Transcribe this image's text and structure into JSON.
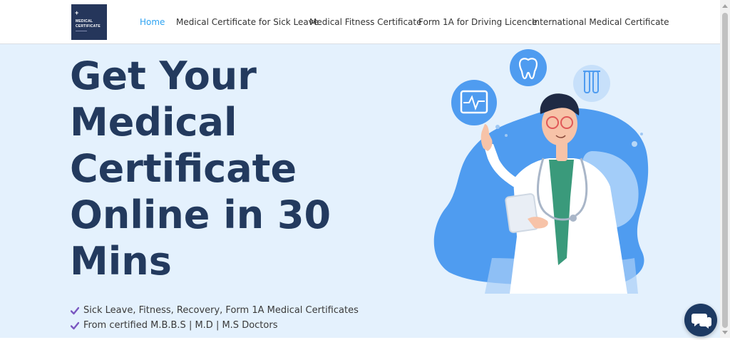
{
  "header": {
    "logo": {
      "line1": "MEDICAL",
      "line2": "CERTIFICATE"
    },
    "nav": [
      {
        "label": "Home",
        "active": true
      },
      {
        "label": "Medical Certificate for Sick Leave",
        "active": false
      },
      {
        "label": "Medical Fitness Certificate",
        "active": false
      },
      {
        "label": "Form 1A for Driving Licence",
        "active": false
      },
      {
        "label": "International Medical Certificate",
        "active": false
      }
    ]
  },
  "hero": {
    "title_lines": [
      "Get Your",
      "Medical",
      "Certificate",
      "Online in 30",
      "Mins"
    ],
    "bullets": [
      "Sick Leave, Fitness, Recovery, Form 1A Medical Certificates",
      "From certified M.B.B.S | M.D | M.S Doctors"
    ]
  },
  "icons": {
    "check": "check-icon",
    "chat": "chat-icon",
    "tooth": "tooth-icon",
    "heart_monitor": "heart-monitor-icon",
    "test_tube": "test-tube-icon"
  },
  "colors": {
    "hero_background": "#e4f1fd",
    "title": "#233a5e",
    "nav_active": "#2ea3f2",
    "check": "#7a57c0",
    "logo_background": "#25365b",
    "chat_button": "#1d3a63"
  }
}
